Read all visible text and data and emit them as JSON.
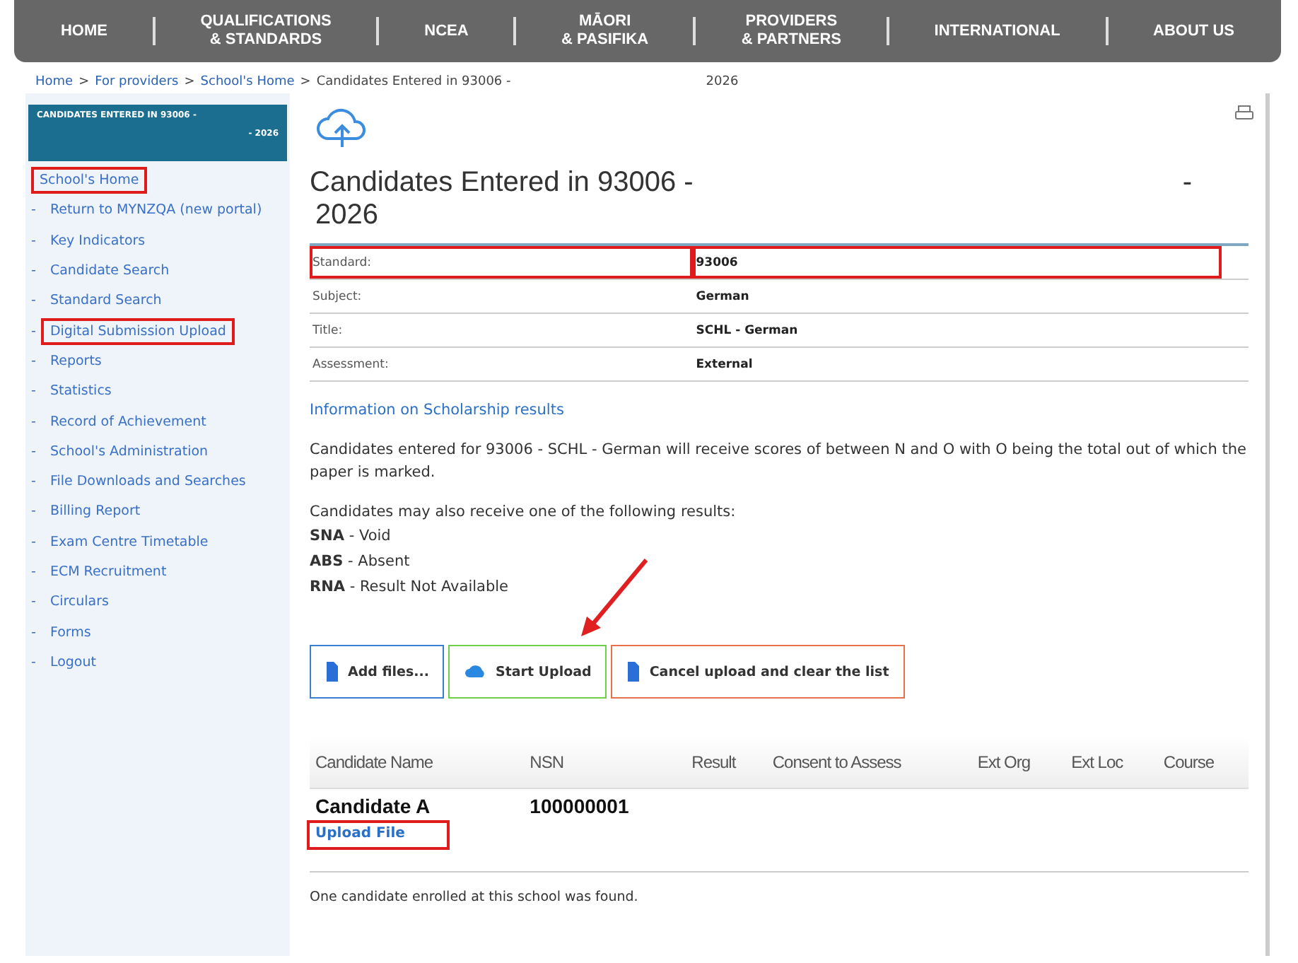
{
  "nav": [
    {
      "label": "HOME"
    },
    {
      "label": "QUALIFICATIONS\n& STANDARDS"
    },
    {
      "label": "NCEA"
    },
    {
      "label": "MĀORI\n& PASIFIKA"
    },
    {
      "label": "PROVIDERS\n& PARTNERS"
    },
    {
      "label": "INTERNATIONAL"
    },
    {
      "label": "ABOUT US"
    }
  ],
  "breadcrumb": {
    "links": [
      "Home",
      "For providers",
      "School's Home"
    ],
    "separator": ">",
    "current": "Candidates Entered in 93006 -",
    "current_end": "2026"
  },
  "sidebar": {
    "header": {
      "line_1": "CANDIDATES ENTERED IN 93006 -",
      "line_2": "- 2026"
    },
    "home_link": {
      "label": "School's Home",
      "highlighted": true
    },
    "items": [
      {
        "label": "Return to MYNZQA (new portal)",
        "bullet": "-",
        "highlighted": false
      },
      {
        "label": "Key Indicators",
        "bullet": "-",
        "highlighted": false
      },
      {
        "label": "Candidate Search",
        "bullet": "-",
        "highlighted": false
      },
      {
        "label": "Standard Search",
        "bullet": "-",
        "highlighted": false
      },
      {
        "label": "Digital Submission Upload",
        "bullet": "-",
        "highlighted": true
      },
      {
        "label": "Reports",
        "bullet": "-",
        "highlighted": false
      },
      {
        "label": "Statistics",
        "bullet": "-",
        "highlighted": false
      },
      {
        "label": "Record of Achievement",
        "bullet": "-",
        "highlighted": false
      },
      {
        "label": "School's Administration",
        "bullet": "-",
        "highlighted": false
      },
      {
        "label": "File Downloads and Searches",
        "bullet": "-",
        "highlighted": false
      },
      {
        "label": "Billing Report",
        "bullet": "-",
        "highlighted": false
      },
      {
        "label": "Exam Centre Timetable",
        "bullet": "-",
        "highlighted": false
      },
      {
        "label": "ECM Recruitment",
        "bullet": "-",
        "highlighted": false
      },
      {
        "label": "Circulars",
        "bullet": "-",
        "highlighted": false
      },
      {
        "label": "Forms",
        "bullet": "-",
        "highlighted": false
      },
      {
        "label": "Logout",
        "bullet": "-",
        "highlighted": false
      }
    ]
  },
  "main": {
    "title_line_1": "Candidates Entered in 93006 -",
    "title_dash": "-",
    "title_line_2": "2026",
    "details": [
      {
        "label": "Standard:",
        "value": "93006",
        "highlighted": true
      },
      {
        "label": "Subject:",
        "value": "German",
        "highlighted": false
      },
      {
        "label": "Title:",
        "value": "SCHL - German",
        "highlighted": false
      },
      {
        "label": "Assessment:",
        "value": "External",
        "highlighted": false
      }
    ],
    "info_link": "Information on Scholarship results",
    "paragraph": "Candidates entered for 93006 - SCHL - German will receive scores of between N and O with O being the total out of which the paper is marked.",
    "results_intro": "Candidates may also receive one of the following results:",
    "results": [
      "**SNA** - Void",
      "**ABS** - Absent",
      "**RNA** - Result Not Available"
    ],
    "buttons": [
      {
        "label": "Add files...",
        "kind": "file",
        "color": "#3b7fd0"
      },
      {
        "label": "Start Upload",
        "kind": "cloud",
        "color": "#6fce4a"
      },
      {
        "label": "Cancel upload and clear the list",
        "kind": "file",
        "color": "#e8704a"
      }
    ],
    "pointer_arrow": {
      "kind": "arrow"
    },
    "table": {
      "columns": [
        "Candidate Name",
        "NSN",
        "Result",
        "Consent to Assess",
        "Ext Org",
        "Ext Loc",
        "Course"
      ],
      "rows": [
        {
          "name": "Candidate A",
          "nsn": "100000001",
          "link": "Upload File",
          "highlighted": true
        }
      ]
    },
    "footer": "One candidate enrolled at this school was found."
  }
}
